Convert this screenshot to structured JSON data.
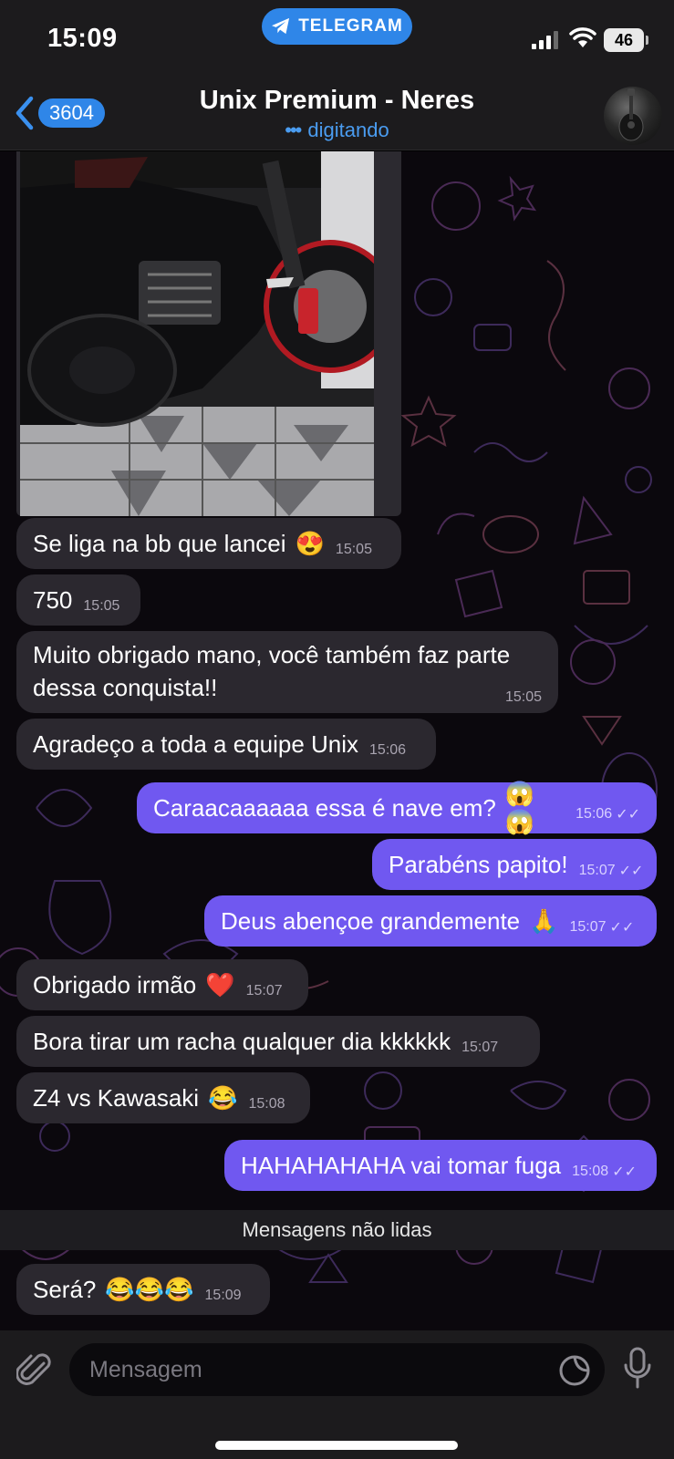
{
  "status_bar": {
    "time": "15:09",
    "app_pill": "TELEGRAM",
    "battery": "46"
  },
  "header": {
    "back_count": "3604",
    "title": "Unix Premium - Neres",
    "subtitle": "digitando",
    "icons": [
      "chevron-left-icon",
      "avatar"
    ]
  },
  "colors": {
    "accent": "#2f86e8",
    "outgoing_bubble": "#7058f0",
    "incoming_bubble": "#2b282f",
    "background": "#0b080d"
  },
  "messages": [
    {
      "dir": "in",
      "text": "Se liga na bb que lancei",
      "emoji": "😍",
      "time": "15:05"
    },
    {
      "dir": "in",
      "text": "750",
      "emoji": "",
      "time": "15:05"
    },
    {
      "dir": "in",
      "text": "Muito obrigado mano, você também faz parte dessa conquista!!",
      "emoji": "",
      "time": "15:05"
    },
    {
      "dir": "in",
      "text": "Agradeço a toda a equipe Unix",
      "emoji": "",
      "time": "15:06"
    },
    {
      "dir": "out",
      "text": "Caraacaaaaaa essa é nave em?",
      "emoji": "😱 😱",
      "time": "15:06"
    },
    {
      "dir": "out",
      "text": "Parabéns papito!",
      "emoji": "",
      "time": "15:07"
    },
    {
      "dir": "out",
      "text": "Deus abençoe grandemente",
      "emoji": "🙏",
      "time": "15:07"
    },
    {
      "dir": "in",
      "text": "Obrigado irmão",
      "emoji": "❤️",
      "time": "15:07"
    },
    {
      "dir": "in",
      "text": "Bora tirar um racha qualquer dia kkkkkk",
      "emoji": "",
      "time": "15:07"
    },
    {
      "dir": "in",
      "text": "Z4 vs Kawasaki",
      "emoji": "😂",
      "time": "15:08"
    },
    {
      "dir": "out",
      "text": "HAHAHAHAHA vai tomar fuga",
      "emoji": "",
      "time": "15:08"
    },
    {
      "dir": "in",
      "text": "Será?",
      "emoji": "😂😂😂",
      "time": "15:09"
    }
  ],
  "unread_divider": "Mensagens não lidas",
  "input": {
    "placeholder": "Mensagem"
  },
  "read_mark": "✓✓"
}
